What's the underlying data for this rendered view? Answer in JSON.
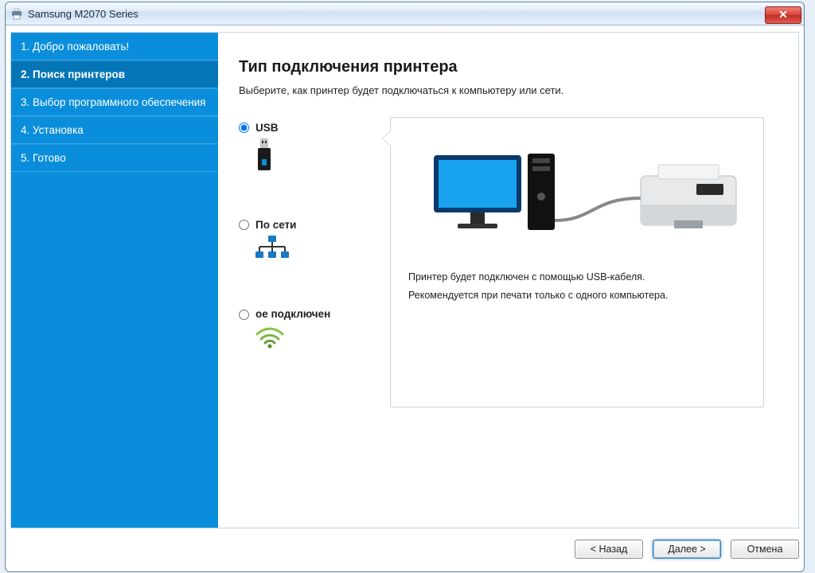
{
  "window": {
    "title": "Samsung M2070 Series",
    "close_glyph": "✕"
  },
  "sidebar": {
    "steps": [
      "1. Добро пожаловать!",
      "2. Поиск принтеров",
      "3. Выбор программного обеспечения",
      "4. Установка",
      "5. Готово"
    ],
    "current": 1
  },
  "main": {
    "heading": "Тип подключения принтера",
    "subheading": "Выберите, как принтер будет подключаться к компьютеру или сети.",
    "options": [
      {
        "id": "usb",
        "label": "USB",
        "selected": true,
        "icon": "usb-stick-icon"
      },
      {
        "id": "network",
        "label": "По сети",
        "selected": false,
        "icon": "lan-network-icon"
      },
      {
        "id": "wireless",
        "label": "ое подключен",
        "selected": false,
        "icon": "wifi-icon"
      }
    ],
    "description": [
      "Принтер будет подключен с помощью USB-кабеля.",
      "Рекомендуется при печати только с одного компьютера."
    ]
  },
  "footer": {
    "back": "< Назад",
    "next": "Далее >",
    "cancel": "Отмена"
  },
  "colors": {
    "sidebar": "#0a8edb",
    "sidebar_active": "#0476b8"
  }
}
